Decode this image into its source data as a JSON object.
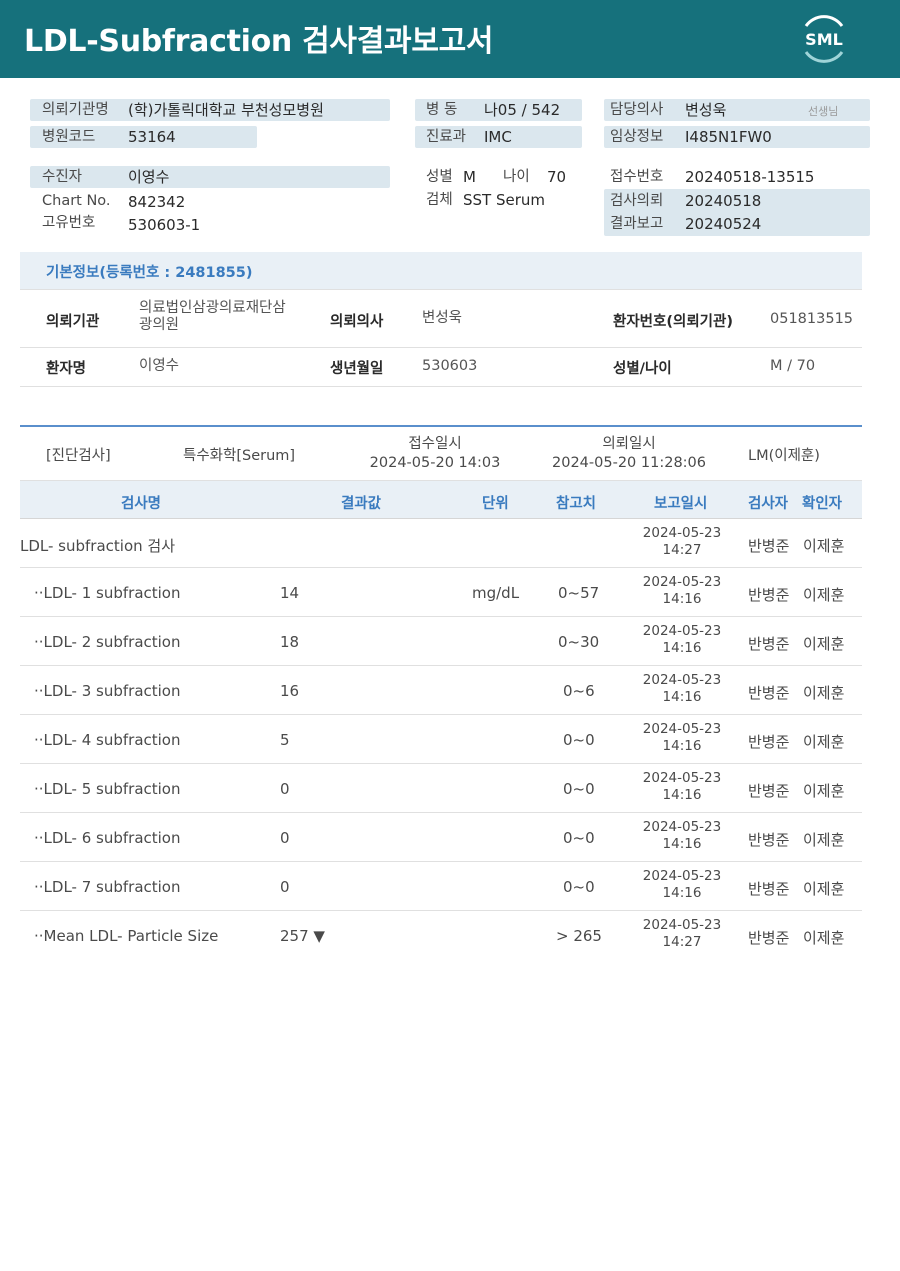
{
  "header": {
    "title": "LDL-Subfraction 검사결과보고서",
    "logo_text": "SML"
  },
  "info": {
    "institution_label": "의뢰기관명",
    "institution": "(학)가톨릭대학교 부천성모병원",
    "hospital_code_label": "병원코드",
    "hospital_code": "53164",
    "ward_label": "병  동",
    "ward": "나05 / 542",
    "dept_label": "진료과",
    "dept": "IMC",
    "doctor_label": "담당의사",
    "doctor": "변성욱",
    "doctor_suffix": "선생님",
    "clinical_label": "임상정보",
    "clinical": "I485N1FW0",
    "patient_label": "수진자",
    "patient": "이영수",
    "chart_label": "Chart No.",
    "chart": "842342",
    "unique_label": "고유번호",
    "unique": "530603-1",
    "sex_label": "성별",
    "sex": "M",
    "age_label": "나이",
    "age": "70",
    "specimen_label": "검체",
    "specimen": "SST Serum",
    "receipt_label": "접수번호",
    "receipt": "20240518-13515",
    "request_label": "검사의뢰",
    "request": "20240518",
    "report_label": "결과보고",
    "report": "20240524"
  },
  "basic": {
    "heading": "기본정보(등록번호 : 2481855)",
    "inst_key": "의뢰기관",
    "inst_val": "의료법인삼광의료재단삼\n광의원",
    "doc_key": "의뢰의사",
    "doc_val": "변성욱",
    "pno_key": "환자번호(의뢰기관)",
    "pno_val": "051813515",
    "name_key": "환자명",
    "name_val": "이영수",
    "birth_key": "생년월일",
    "birth_val": "530603",
    "sexage_key": "성별/나이",
    "sexage_val": "M / 70"
  },
  "diag": {
    "category": "[진단검사]",
    "type": "특수화학[Serum]",
    "received_label": "접수일시",
    "received": "2024-05-20 14:03",
    "requested_label": "의뢰일시",
    "requested": "2024-05-20 11:28:06",
    "lm": "LM(이제훈)"
  },
  "table": {
    "headers": {
      "name": "검사명",
      "result": "결과값",
      "unit": "단위",
      "ref": "참고치",
      "date": "보고일시",
      "tester": "검사자",
      "confirmer": "확인자"
    },
    "rows": [
      {
        "name": "LDL- subfraction 검사",
        "result": "",
        "unit": "",
        "ref": "",
        "date1": "2024-05-23",
        "date2": "14:27",
        "tester": "반병준",
        "confirmer": "이제훈"
      },
      {
        "name": "··LDL- 1 subfraction",
        "result": "14",
        "unit": "mg/dL",
        "ref": "0~57",
        "date1": "2024-05-23",
        "date2": "14:16",
        "tester": "반병준",
        "confirmer": "이제훈"
      },
      {
        "name": "··LDL- 2 subfraction",
        "result": "18",
        "unit": "",
        "ref": "0~30",
        "date1": "2024-05-23",
        "date2": "14:16",
        "tester": "반병준",
        "confirmer": "이제훈"
      },
      {
        "name": "··LDL- 3 subfraction",
        "result": "16",
        "unit": "",
        "ref": "0~6",
        "date1": "2024-05-23",
        "date2": "14:16",
        "tester": "반병준",
        "confirmer": "이제훈"
      },
      {
        "name": "··LDL- 4 subfraction",
        "result": "5",
        "unit": "",
        "ref": "0~0",
        "date1": "2024-05-23",
        "date2": "14:16",
        "tester": "반병준",
        "confirmer": "이제훈"
      },
      {
        "name": "··LDL- 5 subfraction",
        "result": "0",
        "unit": "",
        "ref": "0~0",
        "date1": "2024-05-23",
        "date2": "14:16",
        "tester": "반병준",
        "confirmer": "이제훈"
      },
      {
        "name": "··LDL- 6 subfraction",
        "result": "0",
        "unit": "",
        "ref": "0~0",
        "date1": "2024-05-23",
        "date2": "14:16",
        "tester": "반병준",
        "confirmer": "이제훈"
      },
      {
        "name": "··LDL- 7 subfraction",
        "result": "0",
        "unit": "",
        "ref": "0~0",
        "date1": "2024-05-23",
        "date2": "14:16",
        "tester": "반병준",
        "confirmer": "이제훈"
      },
      {
        "name": "··Mean LDL- Particle Size",
        "result": "257 ▼",
        "unit": "",
        "ref": "> 265",
        "date1": "2024-05-23",
        "date2": "14:27",
        "tester": "반병준",
        "confirmer": "이제훈"
      }
    ]
  }
}
